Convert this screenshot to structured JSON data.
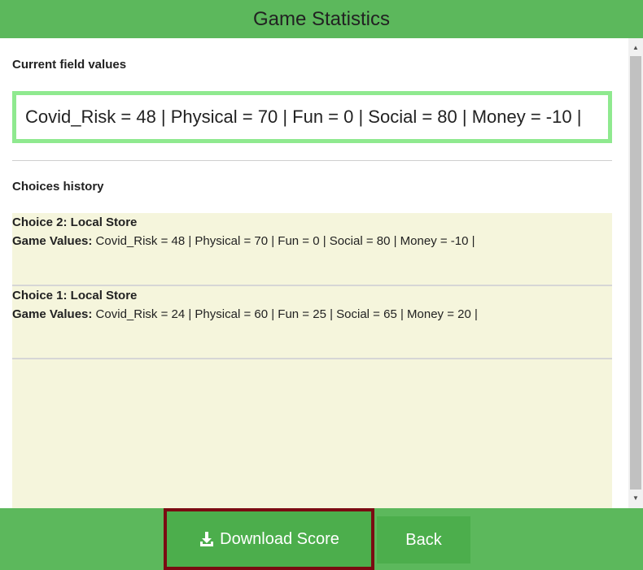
{
  "header": {
    "title": "Game Statistics"
  },
  "current": {
    "label": "Current field values",
    "values_text": "Covid_Risk = 48 | Physical = 70 | Fun = 0 | Social = 80 | Money = -10 |"
  },
  "history": {
    "label": "Choices history",
    "items": [
      {
        "title": "Choice 2: Local Store",
        "values_label": "Game Values:",
        "values_text": " Covid_Risk = 48 | Physical = 70 | Fun = 0 | Social = 80 | Money = -10 |"
      },
      {
        "title": "Choice 1: Local Store",
        "values_label": "Game Values:",
        "values_text": " Covid_Risk = 24 | Physical = 60 | Fun = 25 | Social = 65 | Money = 20 |"
      }
    ]
  },
  "footer": {
    "download_label": "Download Score",
    "download_icon": "download-icon",
    "back_label": "Back"
  },
  "colors": {
    "header_bg": "#5cb85c",
    "button_bg": "#4cae4c",
    "current_border": "#8fe98f",
    "history_bg": "#f5f5dc",
    "focus_outline": "#7a0b12"
  }
}
